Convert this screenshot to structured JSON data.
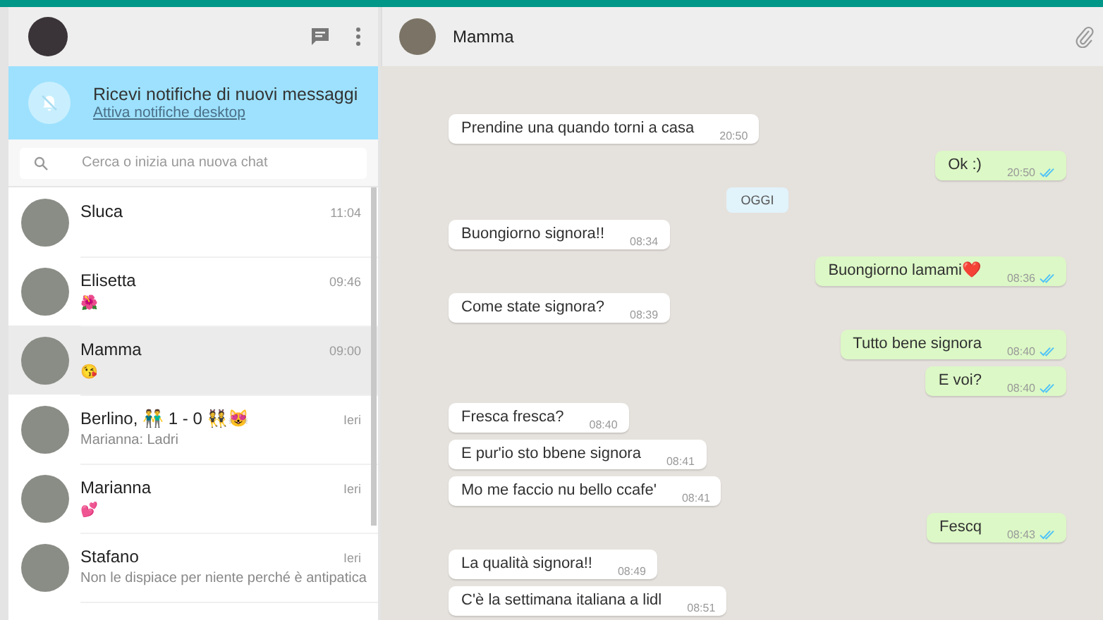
{
  "notification": {
    "title": "Ricevi notifiche di nuovi messaggi",
    "link": "Attiva notifiche desktop"
  },
  "search": {
    "placeholder": "Cerca o inizia una nuova chat"
  },
  "chats": [
    {
      "name": "Sluca",
      "time": "11:04",
      "selected": false
    },
    {
      "name": "Elisetta",
      "time": "09:46",
      "preview": "🌺",
      "selected": false
    },
    {
      "name": "Mamma",
      "time": "09:00",
      "preview": "😘",
      "selected": true
    },
    {
      "name": "Berlino, 👬 1 - 0 👯😻",
      "time": "Ieri",
      "preview": "Marianna: Ladri",
      "selected": false
    },
    {
      "name": "Marianna",
      "time": "Ieri",
      "preview": "💕",
      "selected": false
    },
    {
      "name": "Stafano",
      "time": "Ieri",
      "preview": "Non le dispiace per niente perché è antipatica",
      "selected": false
    }
  ],
  "conversation": {
    "title": "Mamma",
    "messages": [
      {
        "kind": "in",
        "text": "Prendine una quando torni a casa",
        "time": "20:50"
      },
      {
        "kind": "out",
        "text": "Ok :)",
        "time": "20:50",
        "read": true
      },
      {
        "kind": "date",
        "text": "OGGI"
      },
      {
        "kind": "in",
        "text": "Buongiorno signora!!",
        "time": "08:34"
      },
      {
        "kind": "out",
        "text": "Buongiorno lamami❤️",
        "time": "08:36",
        "read": true
      },
      {
        "kind": "in",
        "text": "Come state signora?",
        "time": "08:39"
      },
      {
        "kind": "out",
        "text": "Tutto bene signora",
        "time": "08:40",
        "read": true
      },
      {
        "kind": "out",
        "text": "E voi?",
        "time": "08:40",
        "read": true
      },
      {
        "kind": "in",
        "text": "Fresca fresca?",
        "time": "08:40"
      },
      {
        "kind": "in",
        "text": "E pur'io sto bbene signora",
        "time": "08:41"
      },
      {
        "kind": "in",
        "text": "Mo me faccio nu bello ccafe'",
        "time": "08:41"
      },
      {
        "kind": "out",
        "text": "Fescq",
        "time": "08:43",
        "read": true
      },
      {
        "kind": "in",
        "text": "La qualità signora!!",
        "time": "08:49"
      },
      {
        "kind": "in",
        "text": "C'è la settimana italiana a lidl",
        "time": "08:51"
      }
    ]
  }
}
